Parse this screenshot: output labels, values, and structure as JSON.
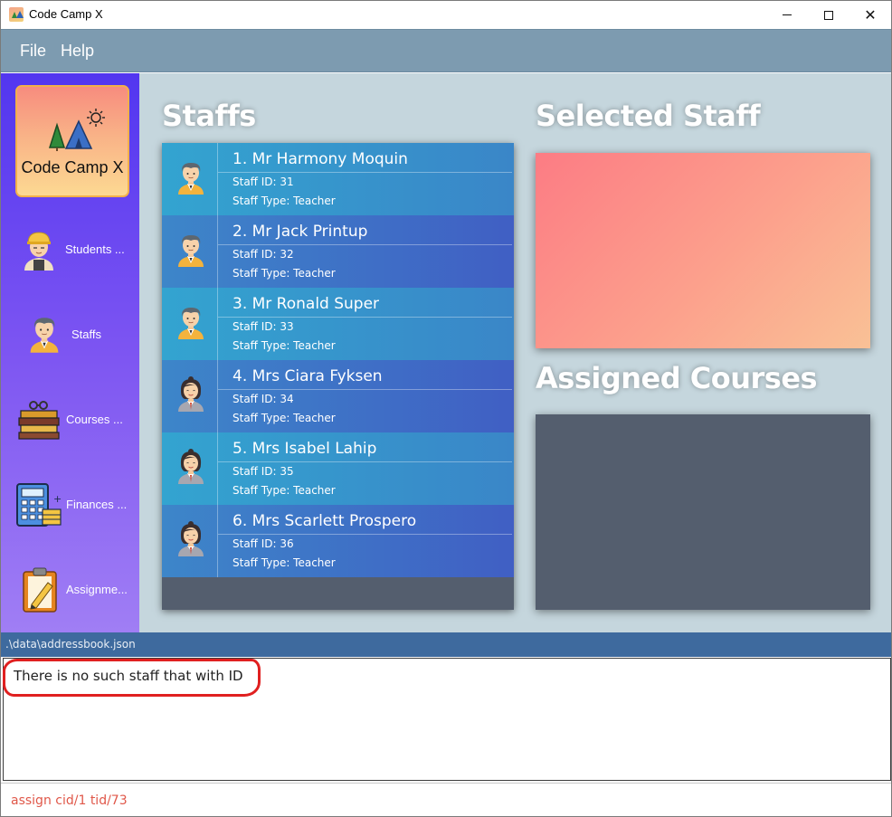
{
  "window": {
    "title": "Code Camp X"
  },
  "menu": {
    "file": "File",
    "help": "Help"
  },
  "sidebar": {
    "logo": "Code Camp X",
    "items": [
      {
        "label": "Students  ...",
        "icon": "student-icon"
      },
      {
        "label": "Staffs",
        "icon": "staff-icon"
      },
      {
        "label": "Courses   ...",
        "icon": "books-icon"
      },
      {
        "label": "Finances  ...",
        "icon": "calculator-icon"
      },
      {
        "label": "Assignme...",
        "icon": "clipboard-icon"
      }
    ]
  },
  "main": {
    "staffs_title": "Staffs",
    "selected_title": "Selected Staff",
    "courses_title": "Assigned Courses",
    "staff": [
      {
        "name": "1. Mr Harmony Moquin",
        "id": "Staff ID: 31",
        "type": "Staff Type: Teacher",
        "avatar": "male"
      },
      {
        "name": "2. Mr Jack Printup",
        "id": "Staff ID: 32",
        "type": "Staff Type: Teacher",
        "avatar": "male"
      },
      {
        "name": "3. Mr Ronald Super",
        "id": "Staff ID: 33",
        "type": "Staff Type: Teacher",
        "avatar": "male"
      },
      {
        "name": "4. Mrs Ciara Fyksen",
        "id": "Staff ID: 34",
        "type": "Staff Type: Teacher",
        "avatar": "female"
      },
      {
        "name": "5. Mrs Isabel Lahip",
        "id": "Staff ID: 35",
        "type": "Staff Type: Teacher",
        "avatar": "female"
      },
      {
        "name": "6. Mrs Scarlett Prospero",
        "id": "Staff ID: 36",
        "type": "Staff Type: Teacher",
        "avatar": "female"
      }
    ]
  },
  "status": {
    "path": ".\\data\\addressbook.json"
  },
  "result": {
    "text": "There is no such staff that with ID"
  },
  "command": {
    "value": "assign cid/1 tid/73"
  },
  "colors": {
    "sidebar_top": "#5236f0",
    "sidebar_bottom": "#a07ef4",
    "highlight": "#e02020",
    "command_text": "#e0584a"
  }
}
